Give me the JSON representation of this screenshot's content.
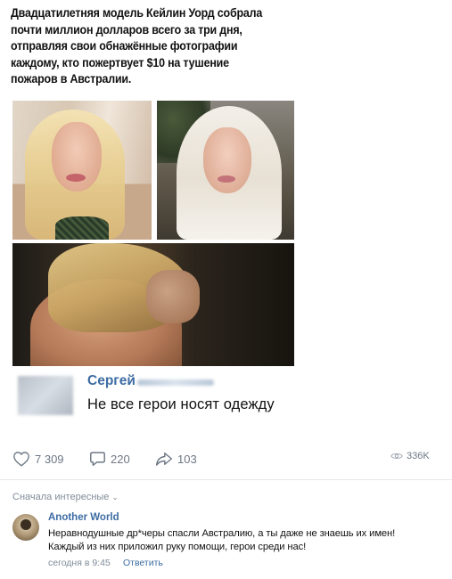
{
  "post": {
    "text_lines": [
      "Двадцатилетняя модель Кейлин Уорд собрала",
      "почти миллион долларов всего за три дня,",
      "отправляя свои обнажённые фотографии",
      "каждому, кто пожертвует $10 на тушение",
      "пожаров в Австралии."
    ]
  },
  "quoted_comment": {
    "author": "Сергей",
    "text": "Не все герои носят одежду"
  },
  "actions": {
    "likes": "7 309",
    "comments": "220",
    "shares": "103",
    "views": "336K"
  },
  "sort": {
    "label": "Сначала интересные",
    "chevron": "⌄"
  },
  "reply": {
    "author": "Another World",
    "line1": "Неравнодушные др*черы спасли Австралию, а ты даже не знаешь их имен!",
    "line2": "Каждый из них приложил руку помощи, герои среди нас!",
    "time": "сегодня в 9:45",
    "reply_label": "Ответить"
  },
  "colors": {
    "link": "#3d6ca3",
    "muted": "#818c99",
    "icon": "#6d7885"
  }
}
